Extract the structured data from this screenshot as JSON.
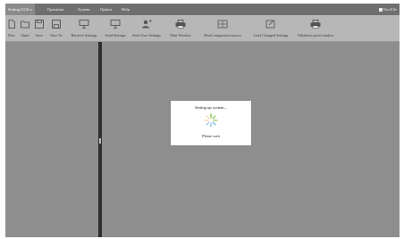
{
  "menubar": {
    "items": [
      {
        "label": "Setting GGS x"
      },
      {
        "label": "Operation"
      },
      {
        "label": "System"
      },
      {
        "label": "Option"
      },
      {
        "label": "Help"
      }
    ],
    "right_label": "NewFile"
  },
  "toolbar": {
    "buttons": [
      {
        "label": "New",
        "icon": "new-file-icon"
      },
      {
        "label": "Open",
        "icon": "open-folder-icon"
      },
      {
        "label": "Save",
        "icon": "save-icon"
      },
      {
        "label": "Save As",
        "icon": "save-as-icon"
      },
      {
        "label": "Retrieve Settings",
        "icon": "retrieve-icon"
      },
      {
        "label": "Send Settings",
        "icon": "send-icon"
      },
      {
        "label": "Send User Settings",
        "icon": "send-user-icon"
      },
      {
        "label": "Print Window",
        "icon": "print-icon"
      },
      {
        "label": "Read comparison source",
        "icon": "comparison-icon"
      },
      {
        "label": "Load Changed Settings",
        "icon": "load-changed-icon"
      },
      {
        "label": "Validation print window",
        "icon": "print-validation-icon"
      }
    ]
  },
  "dialog": {
    "title": "Setting up system...",
    "message": "Please wait"
  },
  "colors": {
    "menubar_bg": "#6f6f6f",
    "toolbar_bg": "#b7b7b7",
    "workspace_bg": "#8e8e8e",
    "spinner_green": "#7dbf3f",
    "spinner_blue": "#3a9ad9"
  }
}
